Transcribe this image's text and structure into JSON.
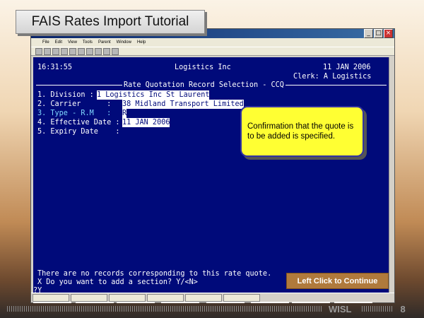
{
  "slide": {
    "title": "FAIS Rates Import Tutorial",
    "callout": "Confirmation that the quote is to be added is specified.",
    "continue_label": "Left Click to Continue",
    "footer_brand": "WISL",
    "page_number": "8"
  },
  "window": {
    "menu_items": [
      "File",
      "Edit",
      "View",
      "Tools",
      "Parent",
      "Window",
      "Help"
    ],
    "controls": {
      "minimize": "_",
      "maximize": "□",
      "close": "×"
    }
  },
  "terminal": {
    "time": "16:31:55",
    "company": "Logistics Inc",
    "date": "11 JAN 2006",
    "clerk": "Clerk: A Logistics",
    "screen_title": "Rate Quotation Record Selection - CCQ",
    "fields": [
      {
        "label": "1. Division :",
        "value": "1 Logistics Inc St Laurent"
      },
      {
        "label": "2. Carrier      :",
        "value": "38 Midland Transport Limited"
      },
      {
        "label": "3. Type - R.M   :",
        "value": "R"
      },
      {
        "label": "4. Effective Date :",
        "value": "11 JAN 2006"
      },
      {
        "label": "5. Expiry Date    :",
        "value": ""
      }
    ],
    "message": "There are no records corresponding to this rate quote.",
    "prompt": "X Do you want to add a section? Y/<N>",
    "input": "?Y",
    "fkeys": [
      "\\",
      "\\G",
      "SRT",
      "\\4",
      "\\0",
      "\\U",
      "\\Z",
      "\\SRT"
    ]
  }
}
